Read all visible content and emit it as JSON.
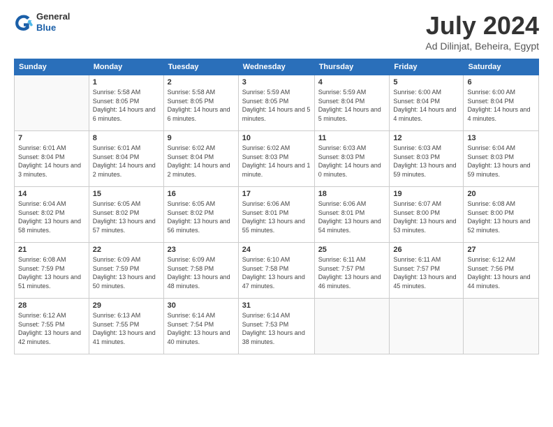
{
  "logo": {
    "general": "General",
    "blue": "Blue"
  },
  "title": {
    "month_year": "July 2024",
    "location": "Ad Dilinjat, Beheira, Egypt"
  },
  "days_of_week": [
    "Sunday",
    "Monday",
    "Tuesday",
    "Wednesday",
    "Thursday",
    "Friday",
    "Saturday"
  ],
  "weeks": [
    [
      {
        "day": "",
        "sunrise": "",
        "sunset": "",
        "daylight": ""
      },
      {
        "day": "1",
        "sunrise": "Sunrise: 5:58 AM",
        "sunset": "Sunset: 8:05 PM",
        "daylight": "Daylight: 14 hours and 6 minutes."
      },
      {
        "day": "2",
        "sunrise": "Sunrise: 5:58 AM",
        "sunset": "Sunset: 8:05 PM",
        "daylight": "Daylight: 14 hours and 6 minutes."
      },
      {
        "day": "3",
        "sunrise": "Sunrise: 5:59 AM",
        "sunset": "Sunset: 8:05 PM",
        "daylight": "Daylight: 14 hours and 5 minutes."
      },
      {
        "day": "4",
        "sunrise": "Sunrise: 5:59 AM",
        "sunset": "Sunset: 8:04 PM",
        "daylight": "Daylight: 14 hours and 5 minutes."
      },
      {
        "day": "5",
        "sunrise": "Sunrise: 6:00 AM",
        "sunset": "Sunset: 8:04 PM",
        "daylight": "Daylight: 14 hours and 4 minutes."
      },
      {
        "day": "6",
        "sunrise": "Sunrise: 6:00 AM",
        "sunset": "Sunset: 8:04 PM",
        "daylight": "Daylight: 14 hours and 4 minutes."
      }
    ],
    [
      {
        "day": "7",
        "sunrise": "Sunrise: 6:01 AM",
        "sunset": "Sunset: 8:04 PM",
        "daylight": "Daylight: 14 hours and 3 minutes."
      },
      {
        "day": "8",
        "sunrise": "Sunrise: 6:01 AM",
        "sunset": "Sunset: 8:04 PM",
        "daylight": "Daylight: 14 hours and 2 minutes."
      },
      {
        "day": "9",
        "sunrise": "Sunrise: 6:02 AM",
        "sunset": "Sunset: 8:04 PM",
        "daylight": "Daylight: 14 hours and 2 minutes."
      },
      {
        "day": "10",
        "sunrise": "Sunrise: 6:02 AM",
        "sunset": "Sunset: 8:03 PM",
        "daylight": "Daylight: 14 hours and 1 minute."
      },
      {
        "day": "11",
        "sunrise": "Sunrise: 6:03 AM",
        "sunset": "Sunset: 8:03 PM",
        "daylight": "Daylight: 14 hours and 0 minutes."
      },
      {
        "day": "12",
        "sunrise": "Sunrise: 6:03 AM",
        "sunset": "Sunset: 8:03 PM",
        "daylight": "Daylight: 13 hours and 59 minutes."
      },
      {
        "day": "13",
        "sunrise": "Sunrise: 6:04 AM",
        "sunset": "Sunset: 8:03 PM",
        "daylight": "Daylight: 13 hours and 59 minutes."
      }
    ],
    [
      {
        "day": "14",
        "sunrise": "Sunrise: 6:04 AM",
        "sunset": "Sunset: 8:02 PM",
        "daylight": "Daylight: 13 hours and 58 minutes."
      },
      {
        "day": "15",
        "sunrise": "Sunrise: 6:05 AM",
        "sunset": "Sunset: 8:02 PM",
        "daylight": "Daylight: 13 hours and 57 minutes."
      },
      {
        "day": "16",
        "sunrise": "Sunrise: 6:05 AM",
        "sunset": "Sunset: 8:02 PM",
        "daylight": "Daylight: 13 hours and 56 minutes."
      },
      {
        "day": "17",
        "sunrise": "Sunrise: 6:06 AM",
        "sunset": "Sunset: 8:01 PM",
        "daylight": "Daylight: 13 hours and 55 minutes."
      },
      {
        "day": "18",
        "sunrise": "Sunrise: 6:06 AM",
        "sunset": "Sunset: 8:01 PM",
        "daylight": "Daylight: 13 hours and 54 minutes."
      },
      {
        "day": "19",
        "sunrise": "Sunrise: 6:07 AM",
        "sunset": "Sunset: 8:00 PM",
        "daylight": "Daylight: 13 hours and 53 minutes."
      },
      {
        "day": "20",
        "sunrise": "Sunrise: 6:08 AM",
        "sunset": "Sunset: 8:00 PM",
        "daylight": "Daylight: 13 hours and 52 minutes."
      }
    ],
    [
      {
        "day": "21",
        "sunrise": "Sunrise: 6:08 AM",
        "sunset": "Sunset: 7:59 PM",
        "daylight": "Daylight: 13 hours and 51 minutes."
      },
      {
        "day": "22",
        "sunrise": "Sunrise: 6:09 AM",
        "sunset": "Sunset: 7:59 PM",
        "daylight": "Daylight: 13 hours and 50 minutes."
      },
      {
        "day": "23",
        "sunrise": "Sunrise: 6:09 AM",
        "sunset": "Sunset: 7:58 PM",
        "daylight": "Daylight: 13 hours and 48 minutes."
      },
      {
        "day": "24",
        "sunrise": "Sunrise: 6:10 AM",
        "sunset": "Sunset: 7:58 PM",
        "daylight": "Daylight: 13 hours and 47 minutes."
      },
      {
        "day": "25",
        "sunrise": "Sunrise: 6:11 AM",
        "sunset": "Sunset: 7:57 PM",
        "daylight": "Daylight: 13 hours and 46 minutes."
      },
      {
        "day": "26",
        "sunrise": "Sunrise: 6:11 AM",
        "sunset": "Sunset: 7:57 PM",
        "daylight": "Daylight: 13 hours and 45 minutes."
      },
      {
        "day": "27",
        "sunrise": "Sunrise: 6:12 AM",
        "sunset": "Sunset: 7:56 PM",
        "daylight": "Daylight: 13 hours and 44 minutes."
      }
    ],
    [
      {
        "day": "28",
        "sunrise": "Sunrise: 6:12 AM",
        "sunset": "Sunset: 7:55 PM",
        "daylight": "Daylight: 13 hours and 42 minutes."
      },
      {
        "day": "29",
        "sunrise": "Sunrise: 6:13 AM",
        "sunset": "Sunset: 7:55 PM",
        "daylight": "Daylight: 13 hours and 41 minutes."
      },
      {
        "day": "30",
        "sunrise": "Sunrise: 6:14 AM",
        "sunset": "Sunset: 7:54 PM",
        "daylight": "Daylight: 13 hours and 40 minutes."
      },
      {
        "day": "31",
        "sunrise": "Sunrise: 6:14 AM",
        "sunset": "Sunset: 7:53 PM",
        "daylight": "Daylight: 13 hours and 38 minutes."
      },
      {
        "day": "",
        "sunrise": "",
        "sunset": "",
        "daylight": ""
      },
      {
        "day": "",
        "sunrise": "",
        "sunset": "",
        "daylight": ""
      },
      {
        "day": "",
        "sunrise": "",
        "sunset": "",
        "daylight": ""
      }
    ]
  ]
}
